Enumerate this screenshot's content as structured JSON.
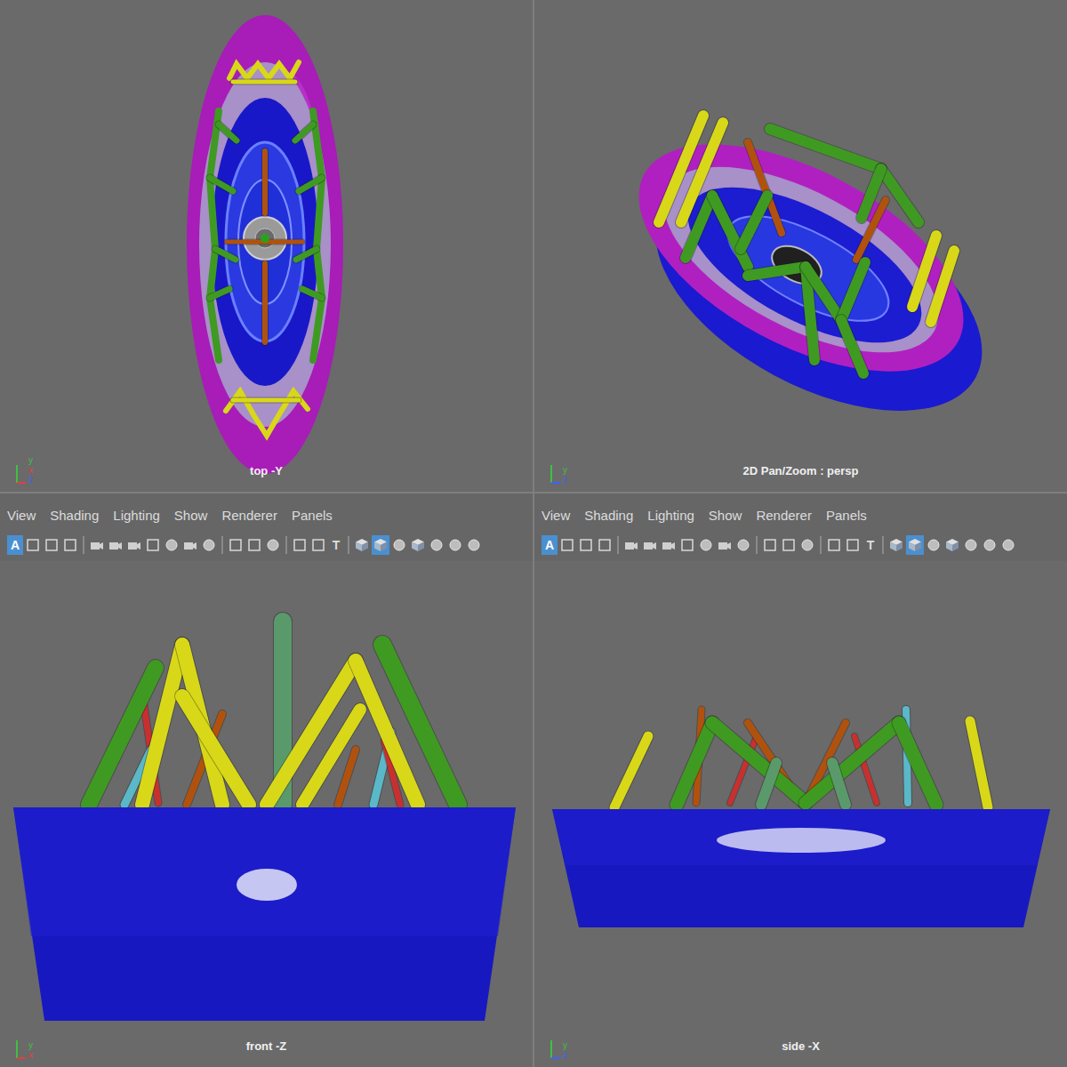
{
  "panels": [
    {
      "label": "top -Y",
      "kind": "top",
      "axes": [
        "y",
        "x",
        "z"
      ],
      "menu": [],
      "toolbar": []
    },
    {
      "label": "2D Pan/Zoom : persp",
      "kind": "persp",
      "axes": [
        "y",
        "z"
      ],
      "menu": [],
      "toolbar": []
    },
    {
      "label": "front -Z",
      "kind": "front",
      "axes": [
        "y",
        "x"
      ],
      "menu": [
        "View",
        "Shading",
        "Lighting",
        "Show",
        "Renderer",
        "Panels"
      ],
      "toolbar": [
        {
          "kind": "glyph",
          "text": "A",
          "selected": true
        },
        {
          "kind": "square",
          "selected": false
        },
        {
          "kind": "square",
          "selected": false
        },
        {
          "kind": "square",
          "selected": false
        },
        {
          "kind": "sep",
          "selected": false
        },
        {
          "kind": "camera",
          "selected": false
        },
        {
          "kind": "camera",
          "selected": false
        },
        {
          "kind": "camera",
          "selected": false
        },
        {
          "kind": "square",
          "selected": false
        },
        {
          "kind": "circle",
          "selected": false
        },
        {
          "kind": "camera",
          "selected": false
        },
        {
          "kind": "circle",
          "selected": false
        },
        {
          "kind": "sep",
          "selected": false
        },
        {
          "kind": "square",
          "selected": false
        },
        {
          "kind": "square",
          "selected": false
        },
        {
          "kind": "circle",
          "selected": false
        },
        {
          "kind": "sep",
          "selected": false
        },
        {
          "kind": "square",
          "selected": false
        },
        {
          "kind": "square",
          "selected": false
        },
        {
          "kind": "glyph",
          "text": "T",
          "selected": false
        },
        {
          "kind": "sep",
          "selected": false
        },
        {
          "kind": "cube",
          "selected": false
        },
        {
          "kind": "cube",
          "selected": true
        },
        {
          "kind": "circle",
          "selected": false
        },
        {
          "kind": "cube",
          "selected": false
        },
        {
          "kind": "circle",
          "selected": false
        },
        {
          "kind": "circle",
          "selected": false
        },
        {
          "kind": "circle",
          "selected": false
        }
      ]
    },
    {
      "label": "side -X",
      "kind": "side",
      "axes": [
        "y",
        "z"
      ],
      "menu": [
        "View",
        "Shading",
        "Lighting",
        "Show",
        "Renderer",
        "Panels"
      ],
      "toolbar": [
        {
          "kind": "glyph",
          "text": "A",
          "selected": true
        },
        {
          "kind": "square",
          "selected": false
        },
        {
          "kind": "square",
          "selected": false
        },
        {
          "kind": "square",
          "selected": false
        },
        {
          "kind": "sep",
          "selected": false
        },
        {
          "kind": "camera",
          "selected": false
        },
        {
          "kind": "camera",
          "selected": false
        },
        {
          "kind": "camera",
          "selected": false
        },
        {
          "kind": "square",
          "selected": false
        },
        {
          "kind": "circle",
          "selected": false
        },
        {
          "kind": "camera",
          "selected": false
        },
        {
          "kind": "circle",
          "selected": false
        },
        {
          "kind": "sep",
          "selected": false
        },
        {
          "kind": "square",
          "selected": false
        },
        {
          "kind": "square",
          "selected": false
        },
        {
          "kind": "circle",
          "selected": false
        },
        {
          "kind": "sep",
          "selected": false
        },
        {
          "kind": "square",
          "selected": false
        },
        {
          "kind": "square",
          "selected": false
        },
        {
          "kind": "glyph",
          "text": "T",
          "selected": false
        },
        {
          "kind": "sep",
          "selected": false
        },
        {
          "kind": "cube",
          "selected": false
        },
        {
          "kind": "cube",
          "selected": true
        },
        {
          "kind": "circle",
          "selected": false
        },
        {
          "kind": "cube",
          "selected": false
        },
        {
          "kind": "circle",
          "selected": false
        },
        {
          "kind": "circle",
          "selected": false
        },
        {
          "kind": "circle",
          "selected": false
        }
      ]
    }
  ]
}
